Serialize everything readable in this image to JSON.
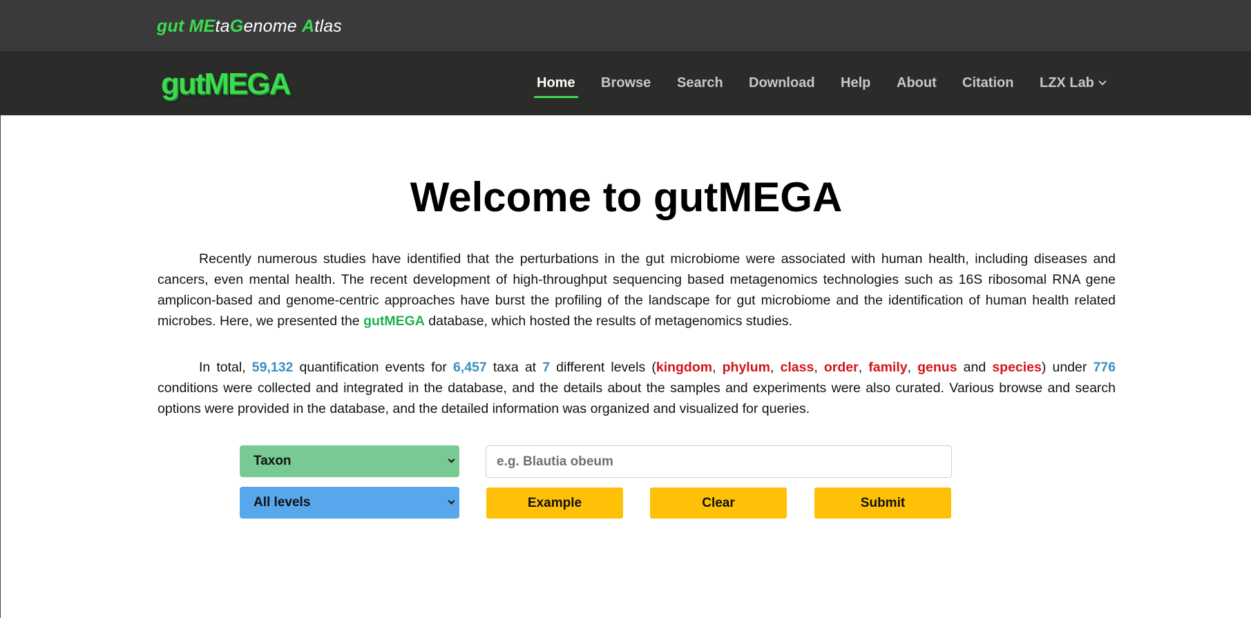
{
  "header": {
    "tagline": [
      {
        "text": "gut ",
        "green": true
      },
      {
        "text": "ME",
        "green": true
      },
      {
        "text": "ta",
        "green": false
      },
      {
        "text": "G",
        "green": true
      },
      {
        "text": "enome ",
        "green": false
      },
      {
        "text": "A",
        "green": true
      },
      {
        "text": "tlas",
        "green": false
      }
    ],
    "brand": "gutMEGA"
  },
  "nav": {
    "items": [
      {
        "label": "Home",
        "active": true
      },
      {
        "label": "Browse",
        "active": false
      },
      {
        "label": "Search",
        "active": false
      },
      {
        "label": "Download",
        "active": false
      },
      {
        "label": "Help",
        "active": false
      },
      {
        "label": "About",
        "active": false
      },
      {
        "label": "Citation",
        "active": false
      },
      {
        "label": "LZX Lab",
        "active": false,
        "dropdown": true
      }
    ]
  },
  "main": {
    "title": "Welcome to gutMEGA",
    "intro": {
      "before": "Recently numerous studies have identified that the perturbations in the gut microbiome were associated with human health, including diseases and cancers, even mental health. The recent development of high-throughput sequencing based metagenomics technologies such as 16S ribosomal RNA gene amplicon-based and genome-centric approaches have burst the profiling of the landscape for gut microbiome and the identification of human health related microbes. Here, we presented the ",
      "highlight": "gutMEGA",
      "after": " database, which hosted the results of metagenomics studies."
    },
    "stats": {
      "t1": "In total, ",
      "events": "59,132",
      "t2": " quantification events for ",
      "taxa": "6,457",
      "t3": " taxa at ",
      "levels_count": "7",
      "t4": " different levels (",
      "levels": [
        "kingdom",
        "phylum",
        "class",
        "order",
        "family",
        "genus",
        "species"
      ],
      "sep_comma": ", ",
      "sep_and": " and ",
      "t5": ") under ",
      "conditions": "776",
      "t6": " conditions were collected and integrated in the database, and the details about the samples and experiments were also curated. Various browse and search options were provided in the database, and the detailed information was organized and visualized for queries."
    }
  },
  "search": {
    "type_select": "Taxon",
    "level_select": "All levels",
    "placeholder": "e.g. Blautia obeum",
    "example_label": "Example",
    "clear_label": "Clear",
    "submit_label": "Submit"
  },
  "colors": {
    "accent_green": "#3ddc50",
    "highlight_blue": "#3a8fbf",
    "highlight_red": "#d4141a",
    "button_yellow": "#ffc107",
    "select_green": "#78c994",
    "select_blue": "#58a6ec"
  },
  "icons": {
    "dropdown": "chevron-down-icon"
  }
}
